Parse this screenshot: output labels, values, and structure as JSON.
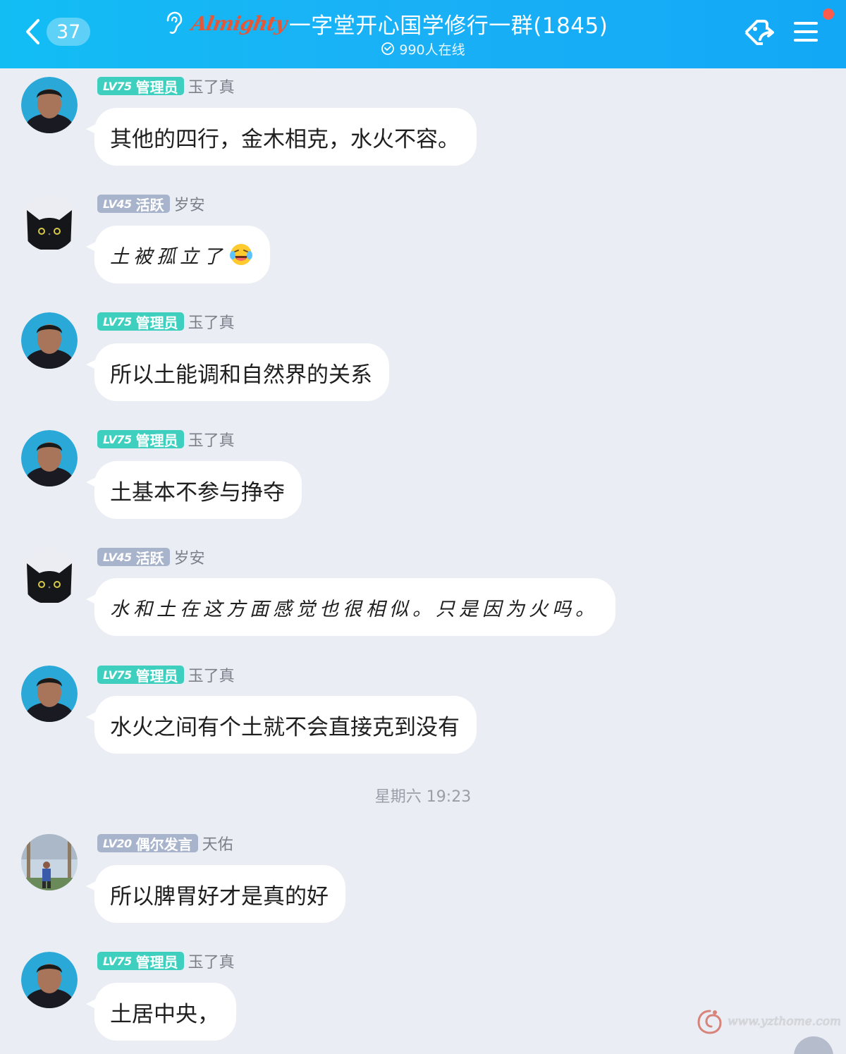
{
  "header": {
    "unread_count": "37",
    "brand": "Almighty",
    "title": "一字堂开心国学修行一群(1845)",
    "online": "990人在线"
  },
  "messages": [
    {
      "badge_level": "LV75",
      "badge_role": "管理员",
      "badge_type": "admin",
      "name": "玉了真",
      "text": "其他的四行，金木相克，水火不容。"
    },
    {
      "badge_level": "LV45",
      "badge_role": "活跃",
      "badge_type": "active",
      "name": "岁安",
      "text": "土被孤立了"
    },
    {
      "badge_level": "LV75",
      "badge_role": "管理员",
      "badge_type": "admin",
      "name": "玉了真",
      "text": "所以土能调和自然界的关系"
    },
    {
      "badge_level": "LV75",
      "badge_role": "管理员",
      "badge_type": "admin",
      "name": "玉了真",
      "text": "土基本不参与挣夺"
    },
    {
      "badge_level": "LV45",
      "badge_role": "活跃",
      "badge_type": "active",
      "name": "岁安",
      "text": "水和土在这方面感觉也很相似。只是因为火吗。"
    },
    {
      "badge_level": "LV75",
      "badge_role": "管理员",
      "badge_type": "admin",
      "name": "玉了真",
      "text": "水火之间有个土就不会直接克到没有"
    },
    {
      "badge_level": "LV20",
      "badge_role": "偶尔发言",
      "badge_type": "occasional",
      "name": "天佑",
      "text": "所以脾胃好才是真的好"
    },
    {
      "badge_level": "LV75",
      "badge_role": "管理员",
      "badge_type": "admin",
      "name": "玉了真",
      "text": "土居中央，"
    }
  ],
  "timestamp": "星期六 19:23",
  "watermark": "www.yzthome.com",
  "icons": {
    "back": "chevron-left-icon",
    "ear": "ear-icon",
    "online": "check-circle-icon",
    "share": "share-icon",
    "menu": "hamburger-menu-icon",
    "emoji": "laughing-tears-emoji"
  },
  "colors": {
    "header": "#16b4f5",
    "admin_badge": "#3fcfbf",
    "member_badge": "#a8b4cc",
    "notification_dot": "#ff5b4d",
    "background": "#eaedf4"
  }
}
